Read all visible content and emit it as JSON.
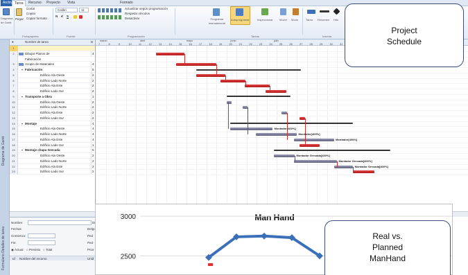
{
  "ribbon": {
    "tabs": [
      "Archivo",
      "Tarea",
      "Recurso",
      "Proyecto",
      "Vista",
      "Formato"
    ],
    "active_tab": 1,
    "view_label": "Diagrama de Gantt",
    "clipboard": {
      "paste": "Pegar",
      "cut": "Cortar",
      "copy": "Copiar",
      "copy_format": "Copiar formato",
      "group": "Portapapeles"
    },
    "font": {
      "name": "Calibri",
      "size": "11",
      "bold": "N",
      "italic": "K",
      "underline": "S",
      "group": "Fuente"
    },
    "schedule": {
      "mark_track": "Actualizar según programación",
      "respect_links": "Respetar vínculos",
      "inactivate": "Desactivar",
      "group": "Programación"
    },
    "tasks": {
      "manual": "Programar manualmente",
      "auto": "Autoprogramar",
      "inspect": "Inspeccionar",
      "move": "Mover",
      "mode": "Modo",
      "group": "Tareas"
    },
    "insert": {
      "task": "Tarea",
      "summary": "Resumen",
      "milestone": "Hito",
      "group": "Insertar"
    },
    "view_vertical": "Diagrama de Gantt",
    "form_vertical": "Formulario Detalles de tarea"
  },
  "table": {
    "header_name": "Nombre de tarea",
    "header_dur": "D",
    "rows": [
      {
        "num": "1",
        "name": "",
        "dur": "",
        "summary": false,
        "indent": 0,
        "icon": false,
        "selected": true
      },
      {
        "num": "2",
        "name": "Dibujar Planos de",
        "dur": "4",
        "summary": false,
        "indent": 0,
        "icon": true
      },
      {
        "num": "",
        "name": "Fabricación",
        "dur": "",
        "summary": false,
        "indent": 0,
        "icon": false
      },
      {
        "num": "3",
        "name": "Acopio de Materiales",
        "dur": "4",
        "summary": false,
        "indent": 0,
        "icon": true
      },
      {
        "num": "4",
        "name": "Fabricación",
        "dur": "5",
        "summary": true,
        "indent": 0,
        "icon": false
      },
      {
        "num": "5",
        "name": "Edificio Ala Oeste",
        "dur": "2",
        "summary": false,
        "indent": 1,
        "icon": false
      },
      {
        "num": "6",
        "name": "Edificio Lado Norte",
        "dur": "2",
        "summary": false,
        "indent": 1,
        "icon": false
      },
      {
        "num": "7",
        "name": "Edificio Ala Este",
        "dur": "2",
        "summary": false,
        "indent": 1,
        "icon": false
      },
      {
        "num": "8",
        "name": "Edificio Lado Sur",
        "dur": "2",
        "summary": false,
        "indent": 1,
        "icon": false
      },
      {
        "num": "9",
        "name": "Transporte a Obra",
        "dur": "1",
        "summary": true,
        "indent": 0,
        "icon": false
      },
      {
        "num": "10",
        "name": "Edificio Ala Oeste",
        "dur": "2",
        "summary": false,
        "indent": 1,
        "icon": false
      },
      {
        "num": "11",
        "name": "Edificio Lado Norte",
        "dur": "2",
        "summary": false,
        "indent": 1,
        "icon": false
      },
      {
        "num": "12",
        "name": "Edificio Ala Este",
        "dur": "2",
        "summary": false,
        "indent": 1,
        "icon": false
      },
      {
        "num": "13",
        "name": "Edificio Lado Sur",
        "dur": "2",
        "summary": false,
        "indent": 1,
        "icon": false
      },
      {
        "num": "14",
        "name": "Montaje",
        "dur": "4",
        "summary": true,
        "indent": 0,
        "icon": false
      },
      {
        "num": "15",
        "name": "Edificio Ala Oeste",
        "dur": "4",
        "summary": false,
        "indent": 1,
        "icon": false
      },
      {
        "num": "16",
        "name": "Edificio Lado Norte",
        "dur": "4",
        "summary": false,
        "indent": 1,
        "icon": false
      },
      {
        "num": "17",
        "name": "Edificio Ala Este",
        "dur": "4",
        "summary": false,
        "indent": 1,
        "icon": false
      },
      {
        "num": "18",
        "name": "Edificio Lado Sur",
        "dur": "1",
        "summary": false,
        "indent": 1,
        "icon": false
      },
      {
        "num": "19",
        "name": "Montaje chapa Grecada",
        "dur": "5",
        "summary": true,
        "indent": 0,
        "icon": false
      },
      {
        "num": "20",
        "name": "Edificio Ala Oeste",
        "dur": "2",
        "summary": false,
        "indent": 1,
        "icon": false
      },
      {
        "num": "21",
        "name": "Edificio Lado Norte",
        "dur": "2",
        "summary": false,
        "indent": 1,
        "icon": false
      },
      {
        "num": "22",
        "name": "Edificio Ala Este",
        "dur": "2",
        "summary": false,
        "indent": 1,
        "icon": false
      },
      {
        "num": "23",
        "name": "Edificio Lado Sur",
        "dur": "2",
        "summary": false,
        "indent": 1,
        "icon": false
      }
    ]
  },
  "timeline": {
    "months": [
      "marzo",
      "abril",
      "mayo",
      "junio",
      "julio"
    ],
    "weeks": [
      "7",
      "8",
      "9",
      "10",
      "11",
      "12",
      "13",
      "14",
      "15",
      "16",
      "17",
      "18",
      "19",
      "20",
      "21",
      "22",
      "23",
      "24",
      "25",
      "26",
      "27",
      "28",
      "29",
      "30",
      "31"
    ]
  },
  "gantt_labels": {
    "l15": "Montador[400%]",
    "l16": "Montador[400%]",
    "l17": "Montador[400%]",
    "l20": "Montador Grecada[400%]",
    "l21": "Montador Grecada[400%]",
    "l22": "Montador Grecada[400%]"
  },
  "form": {
    "name_label": "Nombre:",
    "dur_label": "Du",
    "dates_label": "Fechas",
    "start_label": "Comienzo:",
    "end_label": "Fin:",
    "start_val": "",
    "end_val": "",
    "effort_label": "Delgo",
    "p1": "Ped",
    "p2": "Ped",
    "actual_label": "Actual",
    "forecast_label": "Previsto",
    "total_label": "Total",
    "priority_label": "Prior",
    "col_id": "Id",
    "col_resource": "Nombre del recurso",
    "col_units": "Unid"
  },
  "callouts": {
    "project": "Project Schedule",
    "real": "Real vs. Planned ManHand"
  },
  "chart_data": {
    "type": "line",
    "title": "Man Hand",
    "xlabel": "",
    "ylabel": "",
    "ytick_labels": [
      "3000",
      "2500"
    ],
    "yvisible": [
      2250,
      3150
    ],
    "series": [
      {
        "name": "",
        "color": "#3b6fb9",
        "x": [
          1,
          2,
          3,
          4,
          5
        ],
        "values": [
          2480,
          2740,
          2750,
          2730,
          2500
        ]
      }
    ],
    "partial_marker": {
      "x": 1.05,
      "value": 2390,
      "color": "#e03030"
    }
  }
}
